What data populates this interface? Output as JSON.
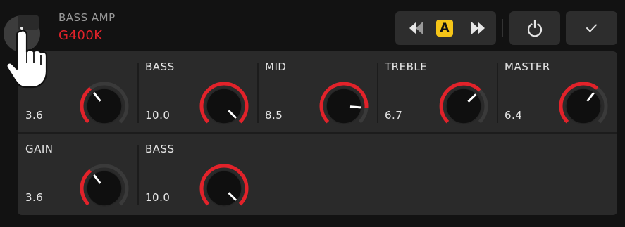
{
  "header": {
    "amp_type": "BASS AMP",
    "amp_model": "G400K",
    "ab_label": "A"
  },
  "icons": {
    "menu": "vertical-dots-icon",
    "prev": "rewind-icon",
    "next": "fast-forward-icon",
    "power": "power-icon",
    "confirm": "checkmark-icon",
    "cursor": "hand-pointer-icon"
  },
  "colors": {
    "accent_red": "#e2222a",
    "ab_badge": "#f5c518",
    "panel": "#2a2a2a",
    "background": "#121212"
  },
  "knobs": [
    {
      "label": "",
      "value": "3.6",
      "level": 0.36
    },
    {
      "label": "BASS",
      "value": "10.0",
      "level": 1.0
    },
    {
      "label": "MID",
      "value": "8.5",
      "level": 0.85
    },
    {
      "label": "TREBLE",
      "value": "6.7",
      "level": 0.67
    },
    {
      "label": "MASTER",
      "value": "6.4",
      "level": 0.64
    },
    {
      "label": "GAIN",
      "value": "3.6",
      "level": 0.36
    },
    {
      "label": "BASS",
      "value": "10.0",
      "level": 1.0
    }
  ]
}
